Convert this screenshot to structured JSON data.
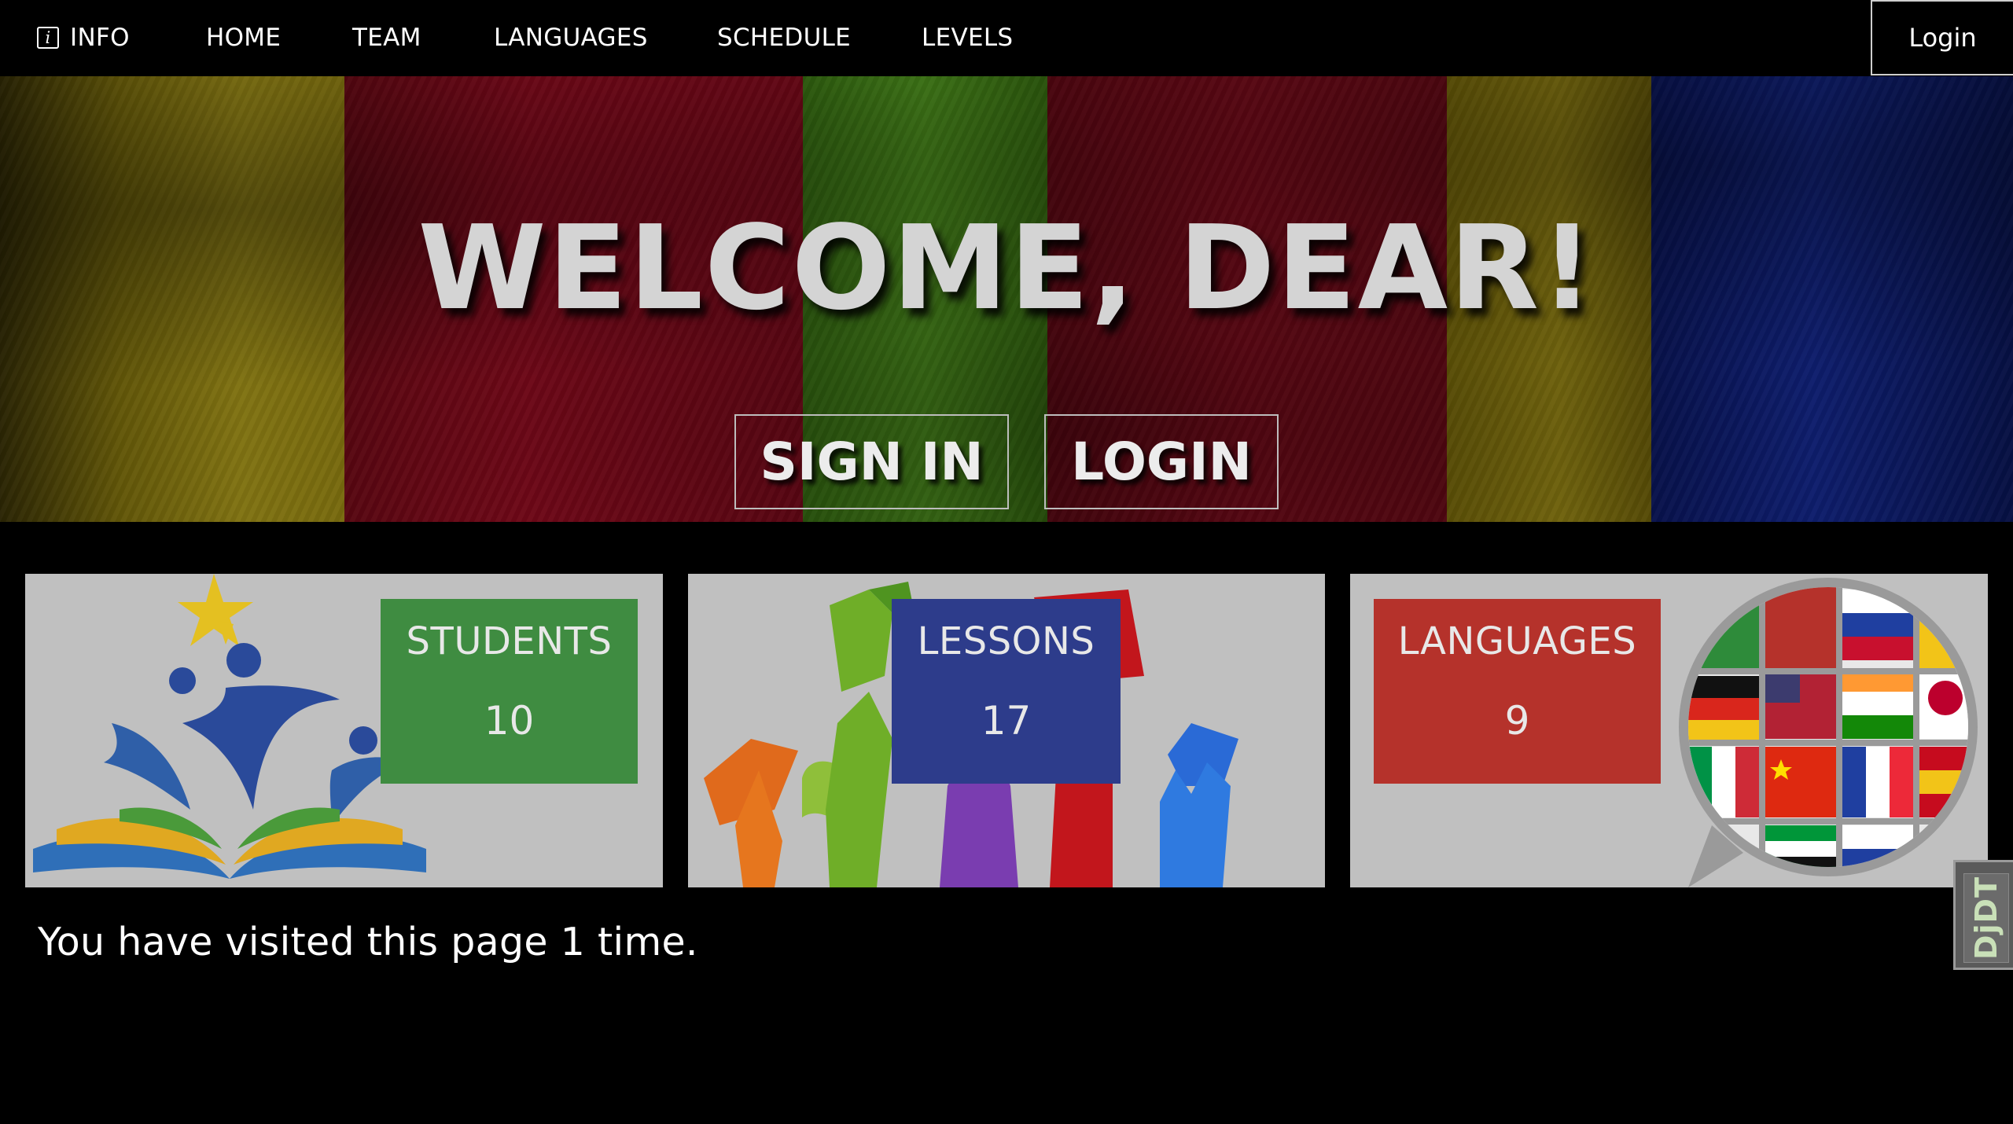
{
  "nav": {
    "info": "INFO",
    "home": "HOME",
    "team": "TEAM",
    "languages": "LANGUAGES",
    "schedule": "SCHEDULE",
    "levels": "LEVELS",
    "login": "Login",
    "info_icon": "info-icon"
  },
  "hero": {
    "title": "WELCOME, DEAR!",
    "sign_in": "SIGN IN",
    "login": "LOGIN",
    "stripe_colors": [
      "#a89514",
      "#9e0c22",
      "#55a01f",
      "#8a0c1e",
      "#a89515",
      "#142998"
    ]
  },
  "cards": [
    {
      "label": "STUDENTS",
      "value": "10",
      "color": "#3f8c41",
      "image": "students-logo-illustration"
    },
    {
      "label": "LESSONS",
      "value": "17",
      "color": "#2d3c8b",
      "image": "hands-and-books-illustration"
    },
    {
      "label": "LANGUAGES",
      "value": "9",
      "color": "#b5322b",
      "image": "flags-globe-speech-bubble-illustration"
    }
  ],
  "footer": {
    "visits": "You have visited this page 1 time.",
    "debug_toolbar": "DjDT"
  }
}
